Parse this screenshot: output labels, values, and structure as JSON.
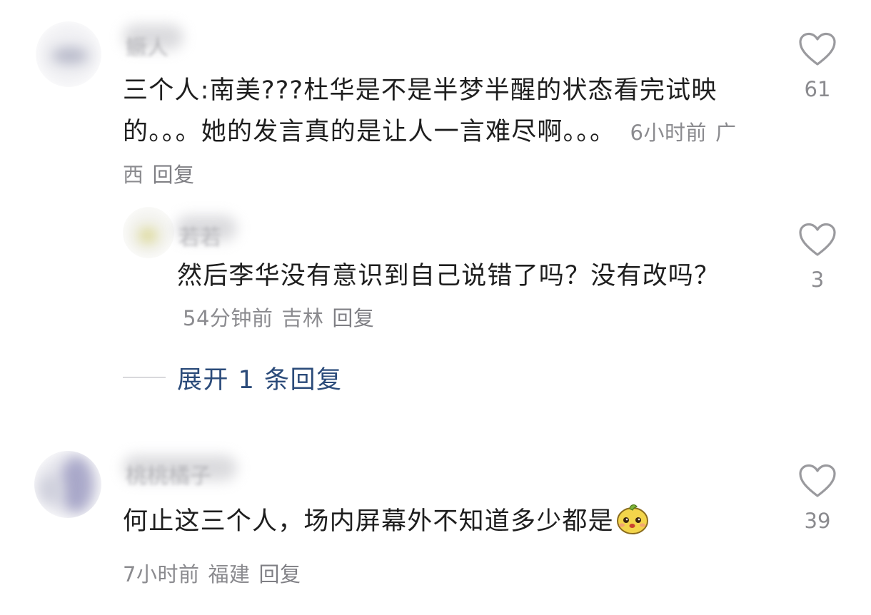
{
  "comments": [
    {
      "name": "鳜人",
      "text": "三个人:南美???杜华是不是半梦半醒的状态看完试映的。。。她的发言真的是让人一言难尽啊。。。",
      "time": "6小时前",
      "location": "广西",
      "reply_label": "回复",
      "likes": "61",
      "icon": "heart-outline-icon"
    },
    {
      "name": "若若",
      "text": "然后李华没有意识到自己说错了吗？没有改吗？",
      "time": "54分钟前",
      "location": "吉林",
      "reply_label": "回复",
      "likes": "3",
      "icon": "heart-outline-icon"
    },
    {
      "name": "桃桃橘子",
      "text": "何止这三个人，场内屏幕外不知道多少都是",
      "emoji": "yellow-face-emoji",
      "time": "7小时前",
      "location": "福建",
      "reply_label": "回复",
      "likes": "39",
      "icon": "heart-outline-icon"
    }
  ],
  "expand_replies": {
    "label": "展开 1 条回复"
  },
  "colors": {
    "text": "#1e1e1e",
    "meta": "#8b8b8f",
    "link": "#2b4b7a",
    "icon": "#9a9a9e"
  }
}
